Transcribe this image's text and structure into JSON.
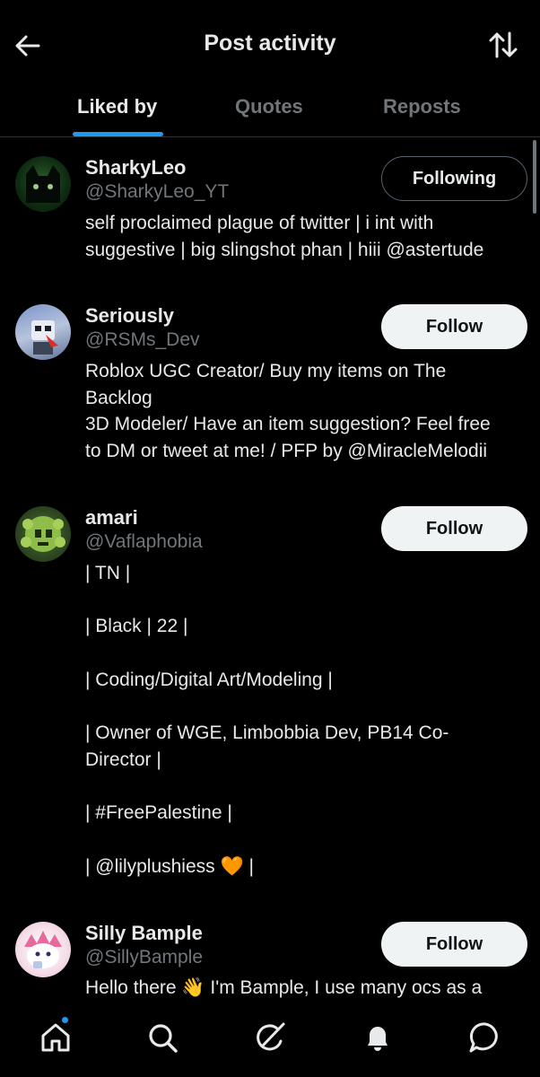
{
  "header": {
    "title": "Post activity"
  },
  "tabs": [
    {
      "label": "Liked by",
      "active": true
    },
    {
      "label": "Quotes",
      "active": false
    },
    {
      "label": "Reposts",
      "active": false
    }
  ],
  "users": [
    {
      "name": "SharkyLeo",
      "handle": "@SharkyLeo_YT",
      "button": "Following",
      "bio": "self proclaimed plague of twitter | i int with\nsuggestive | big slingshot phan | hiii @astertude"
    },
    {
      "name": "Seriously",
      "handle": "@RSMs_Dev",
      "button": "Follow",
      "bio": "Roblox UGC Creator/ Buy my items on The\nBacklog\n3D Modeler/ Have an item suggestion? Feel free\nto DM or tweet at me! / PFP by @MiracleMelodii"
    },
    {
      "name": "amari",
      "handle": "@Vaflaphobia",
      "button": "Follow",
      "bio": "| TN |\n\n| Black | 22 |\n\n| Coding/Digital Art/Modeling |\n\n| Owner of WGE, Limbobbia Dev, PB14 Co-\nDirector |\n\n| #FreePalestine |\n\n| @lilyplushiess 🧡 |"
    },
    {
      "name": "Silly Bample",
      "handle": "@SillyBample",
      "button": "Follow",
      "bio": "Hello there 👋 I'm Bample, I use many ocs as a"
    }
  ],
  "icons": {
    "back": "arrow-left-icon",
    "sort": "sort-arrows-icon",
    "nav": [
      "home-icon",
      "search-icon",
      "grok-icon",
      "bell-icon",
      "messages-icon"
    ]
  },
  "colors": {
    "accent": "#1d9bf0",
    "background": "#000000",
    "muted": "#71767b"
  }
}
